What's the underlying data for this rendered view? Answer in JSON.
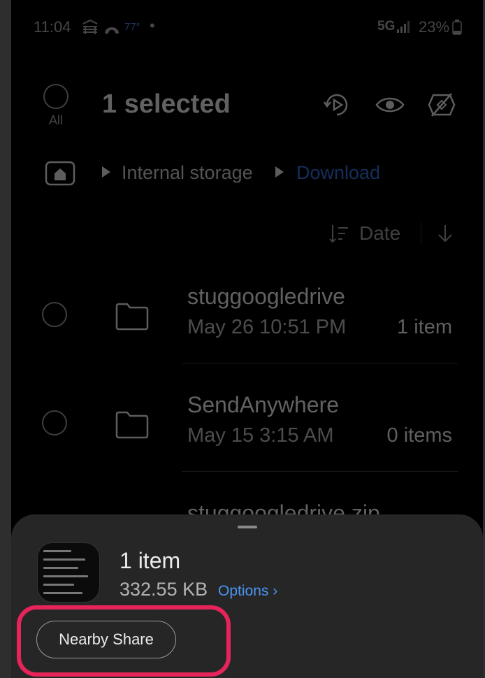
{
  "status_bar": {
    "time": "11:04",
    "temperature": "77°",
    "dot": "•",
    "network": "5G",
    "battery": "23%",
    "icons": [
      "storage-icon",
      "nearby-icon",
      "signal-icon",
      "battery-icon"
    ]
  },
  "header": {
    "select_all_label": "All",
    "title": "1 selected",
    "actions": [
      "video-play-icon",
      "eye-icon",
      "hide-icon"
    ]
  },
  "breadcrumb": {
    "items": [
      "Internal storage",
      "Download"
    ]
  },
  "sort": {
    "label": "Date"
  },
  "files": [
    {
      "name": "stuggoogledrive",
      "date": "May 26 10:51 PM",
      "count": "1 item"
    },
    {
      "name": "SendAnywhere",
      "date": "May 15 3:15 AM",
      "count": "0 items"
    },
    {
      "name": "stuggoogledrive.zip",
      "date": "",
      "count": ""
    }
  ],
  "sheet": {
    "item_count": "1 item",
    "size": "332.55 KB",
    "options_label": "Options",
    "options_chevron": "›",
    "nearby_label": "Nearby Share"
  },
  "colors": {
    "accent_blue": "#4a95f3",
    "breadcrumb_active": "#2f67c8",
    "highlight": "#e6245a"
  }
}
